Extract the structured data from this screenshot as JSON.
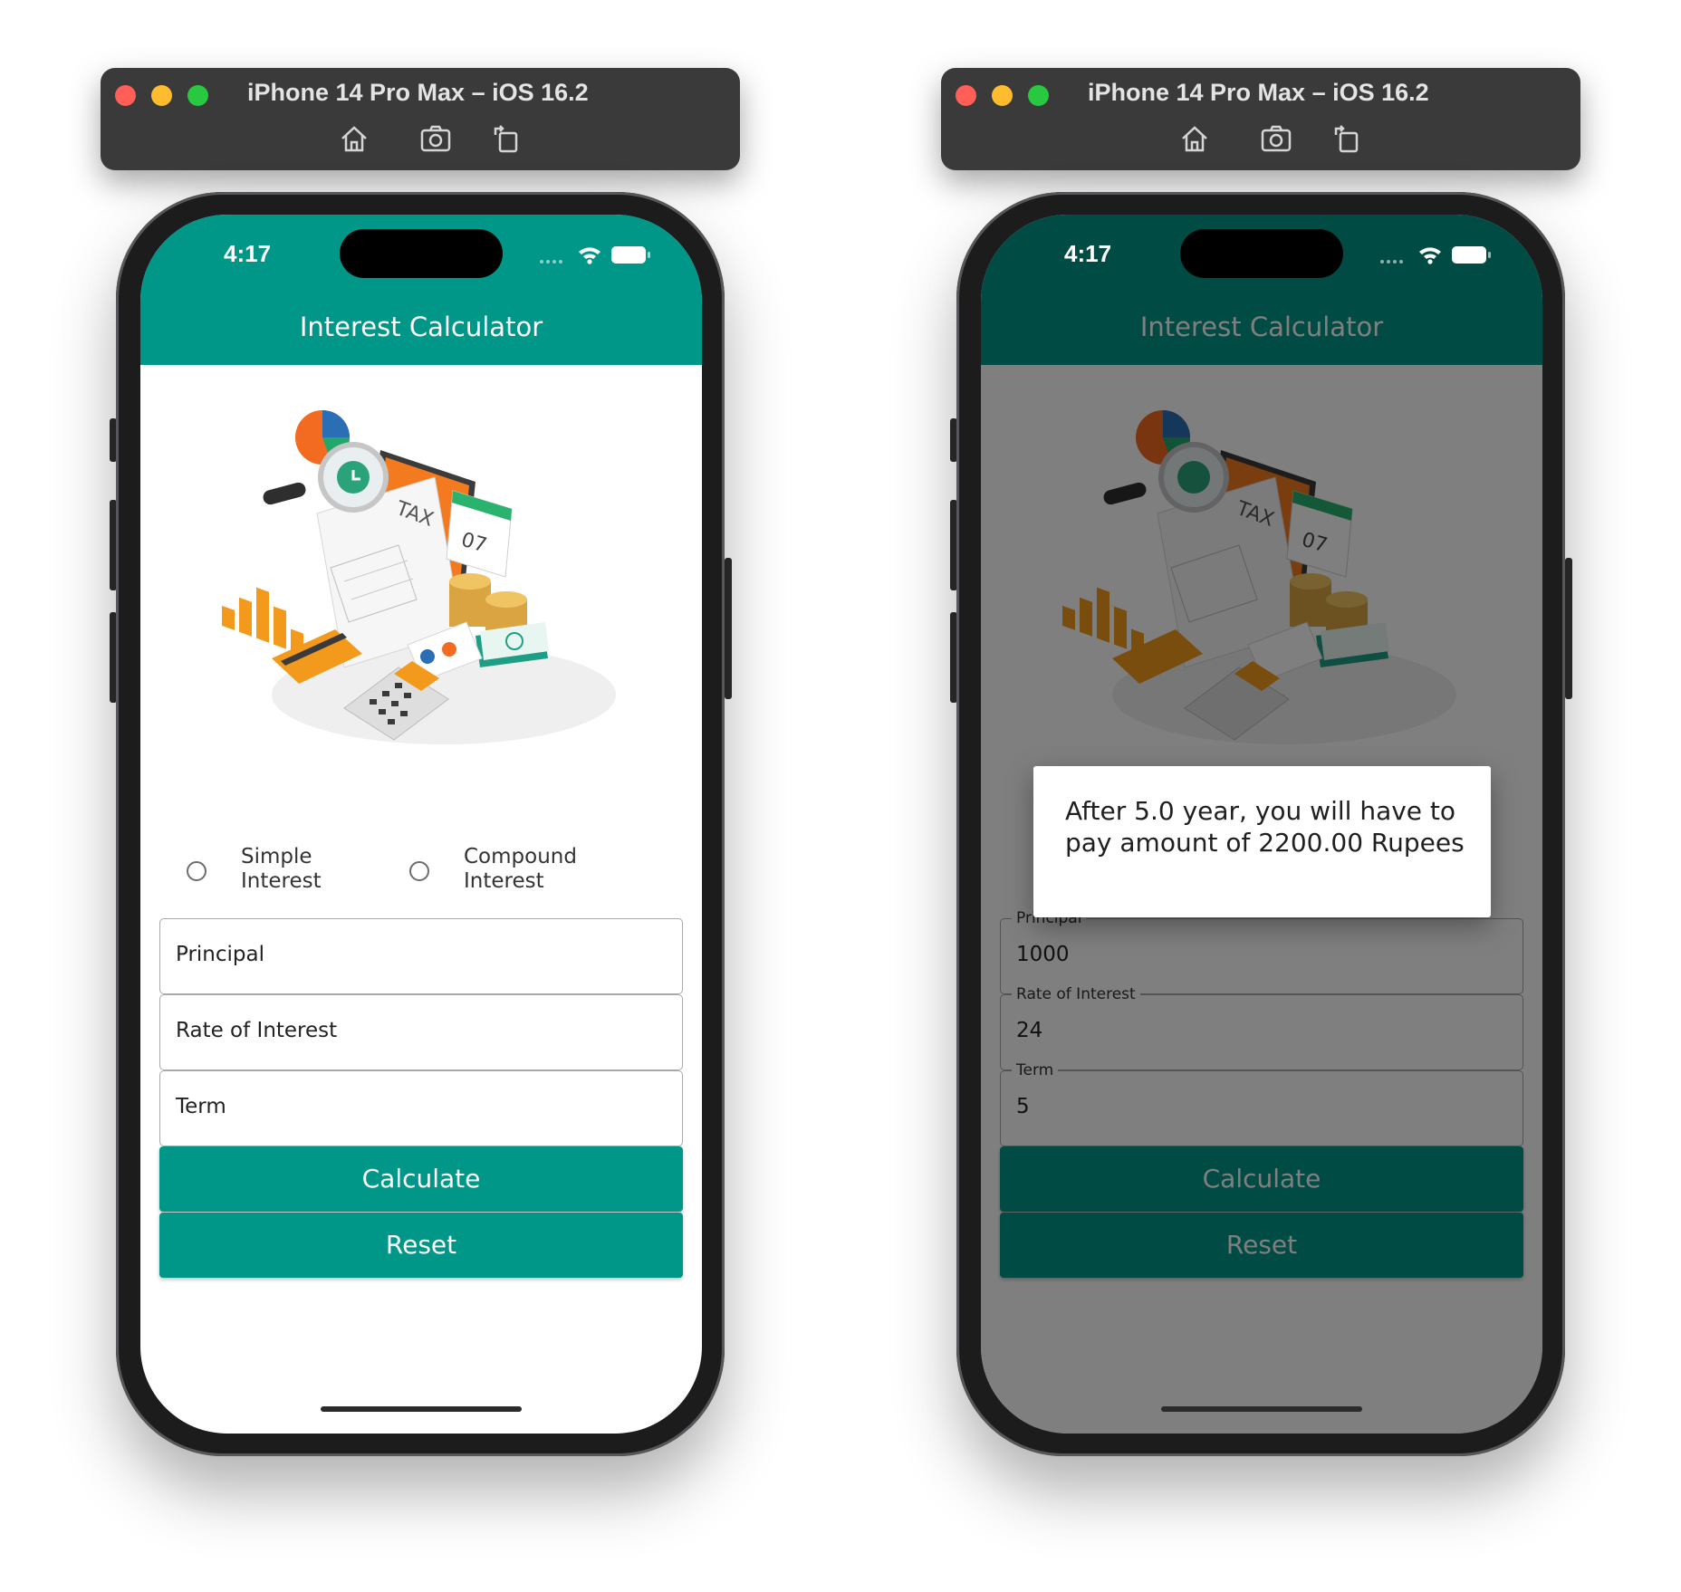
{
  "simulators": [
    {
      "window_title": "iPhone 14 Pro Max – iOS 16.2",
      "status_time": "4:17",
      "app_title": "Interest Calculator",
      "radio_options": [
        "Simple\nInterest",
        "Compound\nInterest"
      ],
      "fields": {
        "principal": {
          "label": "Principal",
          "value": ""
        },
        "rate": {
          "label": "Rate of Interest",
          "value": ""
        },
        "term": {
          "label": "Term",
          "value": ""
        }
      },
      "buttons": {
        "calculate": "Calculate",
        "reset": "Reset"
      }
    },
    {
      "window_title": "iPhone 14 Pro Max – iOS 16.2",
      "status_time": "4:17",
      "app_title": "Interest Calculator",
      "fields": {
        "principal": {
          "label": "Principal",
          "value": "1000"
        },
        "rate": {
          "label": "Rate of Interest",
          "value": "24"
        },
        "term": {
          "label": "Term",
          "value": "5"
        }
      },
      "buttons": {
        "calculate": "Calculate",
        "reset": "Reset"
      },
      "dialog": {
        "message": "After 5.0 year, you will have to pay amount of 2200.00 Rupees"
      }
    }
  ],
  "illustration_text": {
    "tax": "TAX",
    "calendar_day": "07"
  },
  "icons": [
    "home-icon",
    "screenshot-icon",
    "rotate-icon",
    "wifi-icon",
    "battery-icon",
    "signal-icon"
  ],
  "colors": {
    "primary": "#009688",
    "primary_dimmed": "#004b44",
    "traffic_red": "#ff5f57",
    "traffic_yellow": "#febc2e",
    "traffic_green": "#28c840"
  }
}
